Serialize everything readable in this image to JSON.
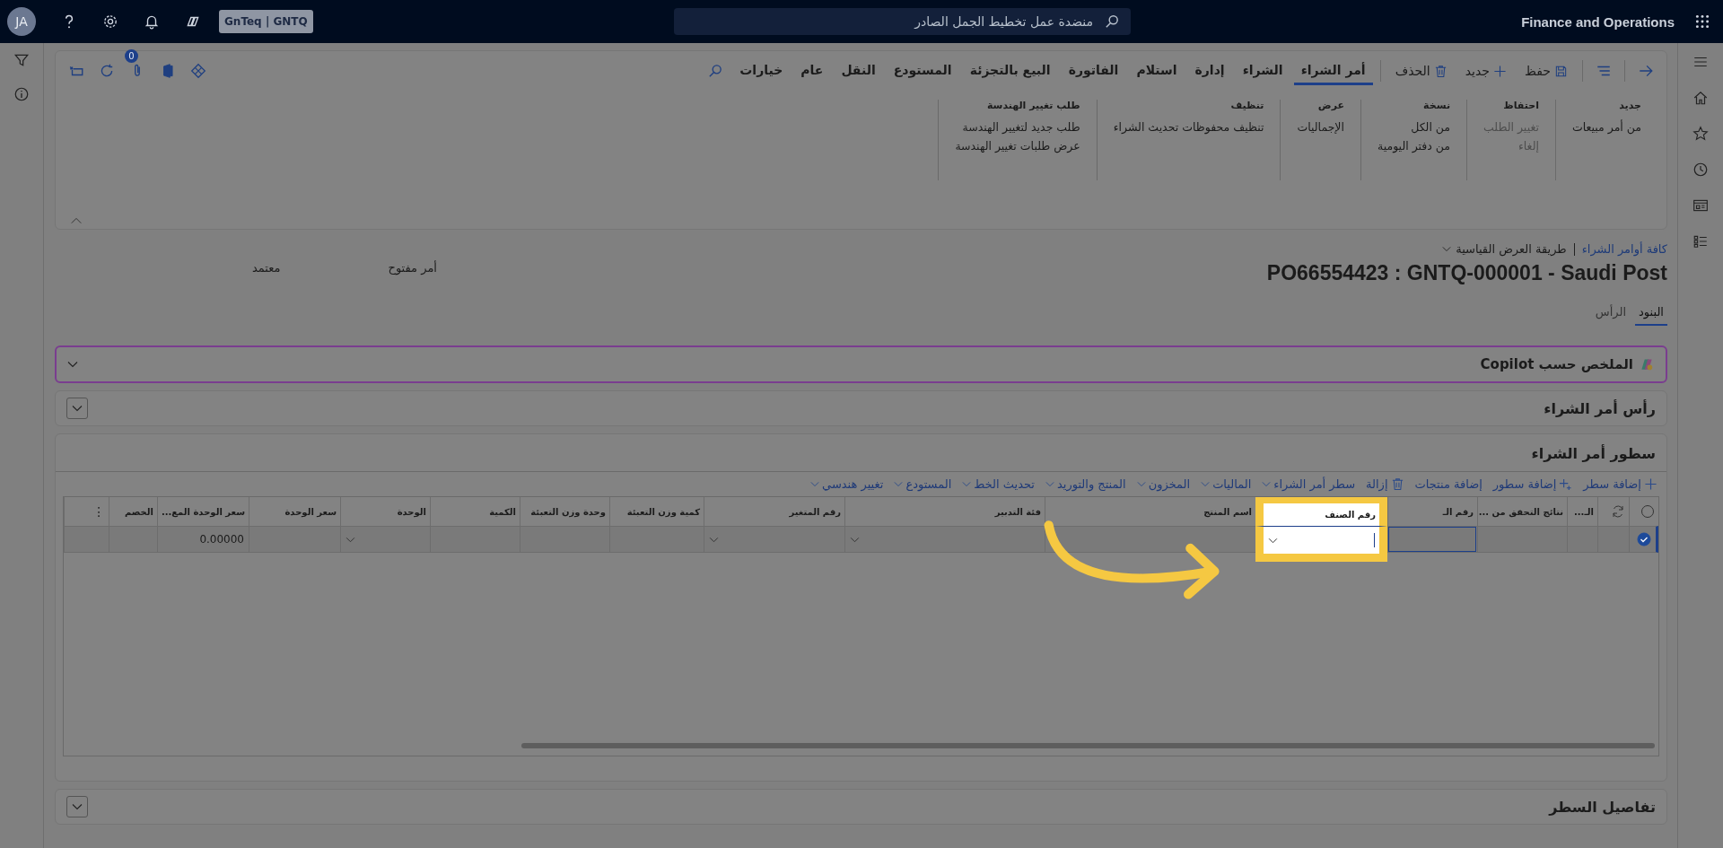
{
  "top_bar": {
    "avatar": "JA",
    "company": "GnTeq | GNTQ",
    "search": {
      "placeholder": "منضدة عمل تخطيط الجمل الصادر"
    },
    "app_name": "Finance and Operations"
  },
  "action_pane": {
    "buttons": [
      {
        "kind": "save",
        "label": "حفظ"
      },
      {
        "kind": "new",
        "label": "جديد"
      },
      {
        "kind": "delete",
        "label": "الحذف"
      }
    ],
    "tabs": [
      {
        "label": "أمر الشراء",
        "selected": true
      },
      {
        "label": "الشراء",
        "selected": false
      },
      {
        "label": "إدارة",
        "selected": false
      },
      {
        "label": "استلام",
        "selected": false
      },
      {
        "label": "الفاتورة",
        "selected": false
      },
      {
        "label": "البيع بالتجزئة",
        "selected": false
      },
      {
        "label": "المستودع",
        "selected": false
      },
      {
        "label": "النقل",
        "selected": false
      },
      {
        "label": "عام",
        "selected": false
      },
      {
        "label": "خيارات",
        "selected": false
      }
    ],
    "attachments_count": "0",
    "groups": [
      {
        "title": "جديد",
        "items": [
          {
            "label": "من أمر مبيعات",
            "disabled": false
          }
        ]
      },
      {
        "title": "احتفاظ",
        "items": [
          {
            "label": "تغيير الطلب",
            "disabled": true
          },
          {
            "label": "إلغاء",
            "disabled": true
          }
        ]
      },
      {
        "title": "نسخة",
        "items": [
          {
            "label": "من الكل",
            "disabled": false
          },
          {
            "label": "من دفتر اليومية",
            "disabled": false
          }
        ]
      },
      {
        "title": "عرض",
        "items": [
          {
            "label": "الإجماليات",
            "disabled": false
          }
        ]
      },
      {
        "title": "تنظيف",
        "items": [
          {
            "label": "تنظيف محفوظات تحديث الشراء",
            "disabled": false
          }
        ]
      },
      {
        "title": "طلب تغيير الهندسة",
        "items": [
          {
            "label": "طلب جديد لتغيير الهندسة",
            "disabled": false
          },
          {
            "label": "عرض طلبات تغيير الهندسة",
            "disabled": false
          }
        ]
      }
    ]
  },
  "breadcrumb": {
    "link": "كافة أوامر الشراء",
    "view": "طريقة العرض القياسية"
  },
  "title": "PO66554423 : GNTQ-000001 - Saudi Post",
  "statuses": [
    "أمر مفتوح",
    "معتمد"
  ],
  "page_tabs": [
    {
      "label": "البنود",
      "selected": true
    },
    {
      "label": "الرأس",
      "selected": false
    }
  ],
  "copilot": {
    "title": "الملخص حسب Copilot"
  },
  "header_section": {
    "title": "رأس أمر الشراء"
  },
  "lines": {
    "title": "سطور أمر الشراء",
    "toolbar": [
      {
        "kind": "add",
        "label": "إضافة سطر"
      },
      {
        "kind": "add-multi",
        "label": "إضافة سطور"
      },
      {
        "kind": "plain",
        "label": "إضافة منتجات"
      },
      {
        "kind": "delete",
        "label": "إزالة"
      },
      {
        "kind": "menu",
        "label": "سطر أمر الشراء"
      },
      {
        "kind": "menu",
        "label": "الماليات"
      },
      {
        "kind": "menu",
        "label": "المخزون"
      },
      {
        "kind": "menu",
        "label": "المنتج والتوريد"
      },
      {
        "kind": "menu",
        "label": "تحديث الخط"
      },
      {
        "kind": "menu",
        "label": "المستودع"
      },
      {
        "kind": "menu",
        "label": "تغيير هندسي"
      }
    ],
    "columns": [
      {
        "kind": "select"
      },
      {
        "kind": "refresh"
      },
      {
        "kind": "text",
        "label": "الـ..."
      },
      {
        "kind": "text",
        "label": "نتائج التحقق من ..."
      },
      {
        "kind": "text",
        "label": "رقم الـ"
      },
      {
        "kind": "dropdown",
        "label": "رقم الصنف",
        "spotlight": true
      },
      {
        "kind": "text",
        "label": "اسم المنتج"
      },
      {
        "kind": "dropdown",
        "label": "فئة التدبير"
      },
      {
        "kind": "dropdown",
        "label": "رقم المتغير"
      },
      {
        "kind": "text",
        "label": "كمية وزن التعبئة"
      },
      {
        "kind": "text",
        "label": "وحدة وزن التعبئة"
      },
      {
        "kind": "text",
        "label": "الكمية"
      },
      {
        "kind": "dropdown",
        "label": "الوحدة"
      },
      {
        "kind": "text",
        "label": "سعر الوحدة"
      },
      {
        "kind": "text",
        "label": "سعر الوحدة المع..."
      },
      {
        "kind": "text",
        "label": "الخصم"
      },
      {
        "kind": "more",
        "label": "⋮"
      }
    ],
    "rows": [
      {
        "selected": true,
        "cells": {
          "14": "0.00000"
        }
      }
    ]
  },
  "line_details": {
    "title": "تفاصيل السطر"
  }
}
